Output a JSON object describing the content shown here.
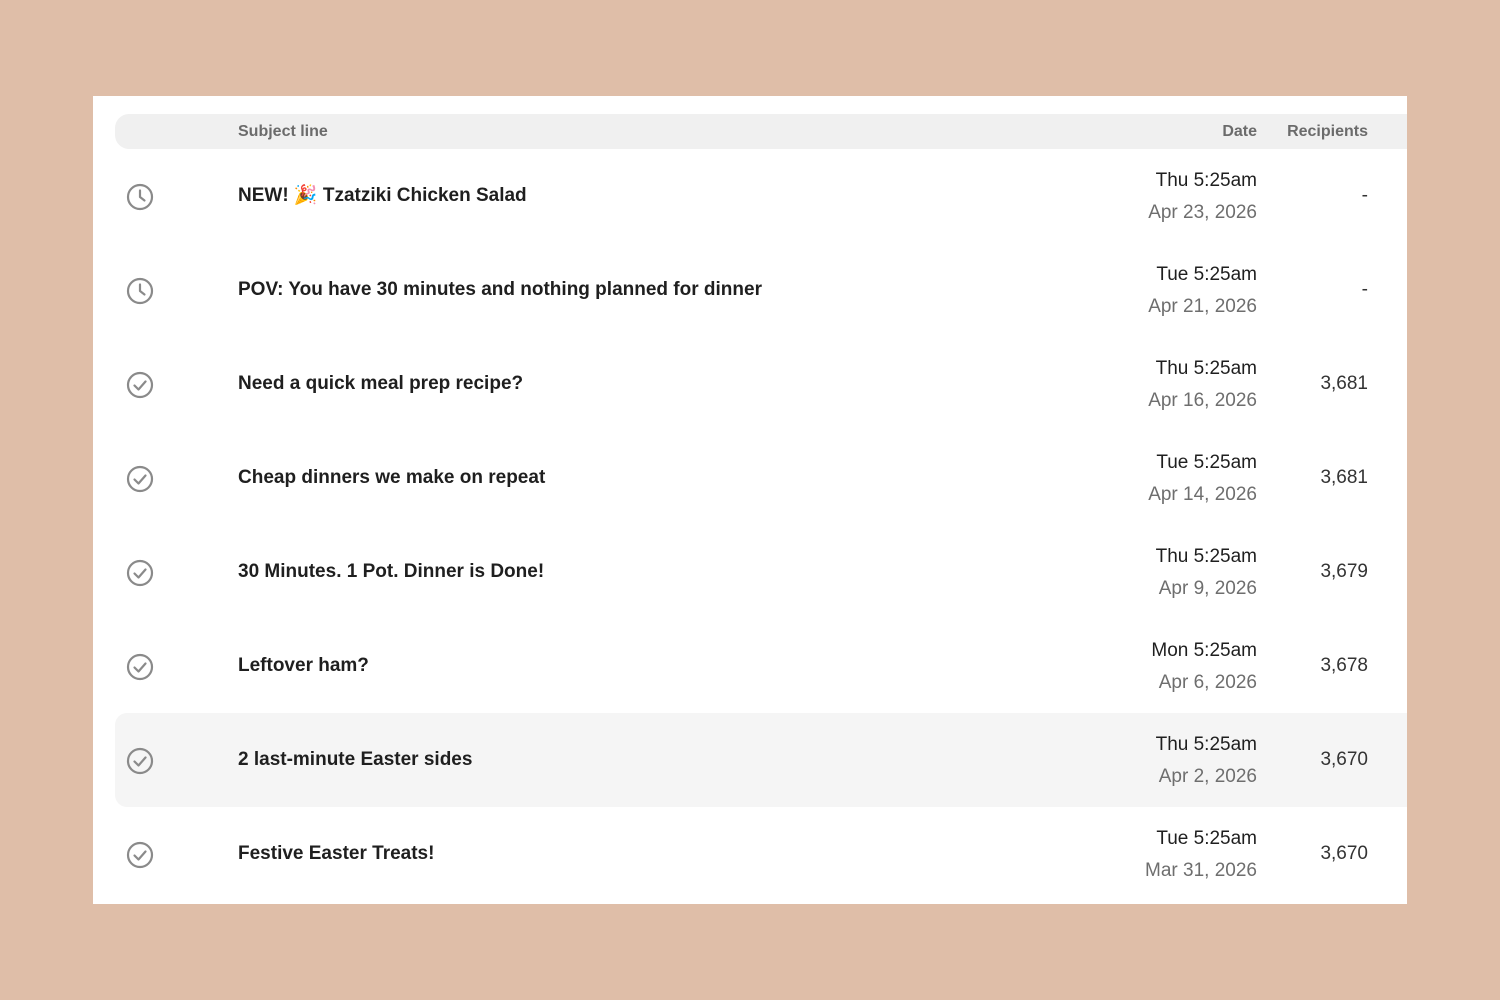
{
  "header": {
    "subject": "Subject line",
    "date": "Date",
    "recipients": "Recipients"
  },
  "colors": {
    "background": "#dfbea8",
    "header_bg": "#f0f0f0",
    "highlight_row": "#f5f5f5",
    "icon": "#8a8a8a"
  },
  "rows": [
    {
      "status_icon": "clock-icon",
      "subject": "NEW! 🎉 Tzatziki Chicken Salad",
      "time": "Thu 5:25am",
      "date": "Apr 23, 2026",
      "recipients": "-"
    },
    {
      "status_icon": "clock-icon",
      "subject": "POV: You have 30 minutes and nothing planned for dinner",
      "time": "Tue 5:25am",
      "date": "Apr 21, 2026",
      "recipients": "-"
    },
    {
      "status_icon": "check-circle-icon",
      "subject": "Need a quick meal prep recipe?",
      "time": "Thu 5:25am",
      "date": "Apr 16, 2026",
      "recipients": "3,681"
    },
    {
      "status_icon": "check-circle-icon",
      "subject": "Cheap dinners we make on repeat",
      "time": "Tue 5:25am",
      "date": "Apr 14, 2026",
      "recipients": "3,681"
    },
    {
      "status_icon": "check-circle-icon",
      "subject": "30 Minutes. 1 Pot. Dinner is Done!",
      "time": "Thu 5:25am",
      "date": "Apr 9, 2026",
      "recipients": "3,679"
    },
    {
      "status_icon": "check-circle-icon",
      "subject": "Leftover ham?",
      "time": "Mon 5:25am",
      "date": "Apr 6, 2026",
      "recipients": "3,678"
    },
    {
      "status_icon": "check-circle-icon",
      "subject": "2 last-minute Easter sides",
      "time": "Thu 5:25am",
      "date": "Apr 2, 2026",
      "recipients": "3,670"
    },
    {
      "status_icon": "check-circle-icon",
      "subject": "Festive Easter Treats!",
      "time": "Tue 5:25am",
      "date": "Mar 31, 2026",
      "recipients": "3,670"
    }
  ]
}
